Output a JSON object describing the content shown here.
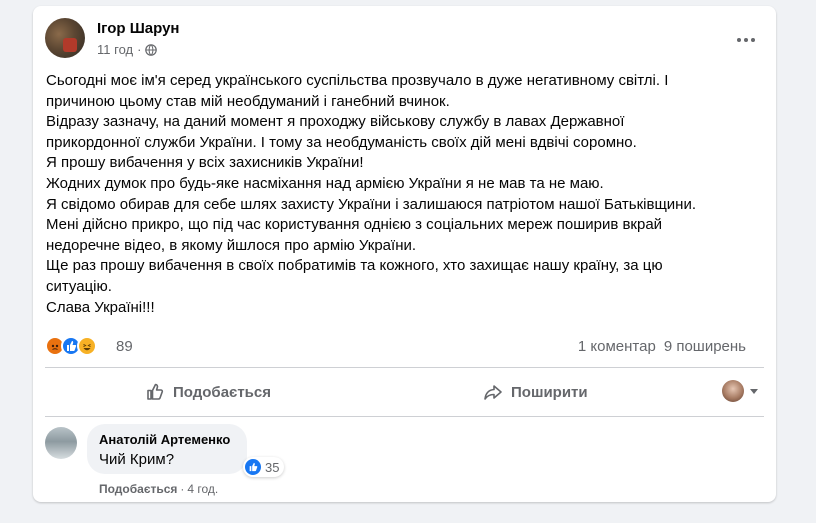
{
  "post": {
    "author": "Ігор Шарун",
    "time": "11 год",
    "separator": "·",
    "body_lines": [
      "Сьогодні моє ім'я серед українського суспільства прозвучало в дуже негативному світлі. І",
      "причиною цьому став мій необдуманий і ганебний вчинок.",
      "Відразу зазначу, на даний момент я проходжу військову службу в лавах Державної",
      "прикордонної служби України. І тому за необдуманість своїх дій мені вдвічі соромно.",
      "Я прошу вибачення у всіх захисників України!",
      "Жодних думок про будь-яке насміхання над армією України я не мав та не маю.",
      "Я свідомо обирав для себе шлях захисту України і залишаюся патріотом нашої Батьківщини.",
      "Мені дійсно прикро, що під час користування однією з соціальних мереж поширив вкрай",
      "недоречне відео, в якому йшлося про армію України.",
      "Ще раз прошу вибачення в своїх побратимів та кожного, хто захищає нашу країну, за цю",
      "ситуацію.",
      "Слава Україні!!!"
    ],
    "reaction_count": "89",
    "comments_count": "1 коментар",
    "shares_count": "9 поширень"
  },
  "actions": {
    "like_label": "Подобається",
    "share_label": "Поширити"
  },
  "comment": {
    "author": "Анатолій Артеменко",
    "text": "Чий Крим?",
    "reaction_count": "35",
    "like_label": "Подобається",
    "separator": "·",
    "time": "4 год."
  },
  "colors": {
    "accent": "#1877f2",
    "secondary_text": "#65676b",
    "background": "#f0f2f5"
  },
  "icons": {
    "privacy": "globe-icon",
    "more": "more-options-icon",
    "like": "thumbs-up-icon",
    "share": "share-arrow-icon"
  }
}
